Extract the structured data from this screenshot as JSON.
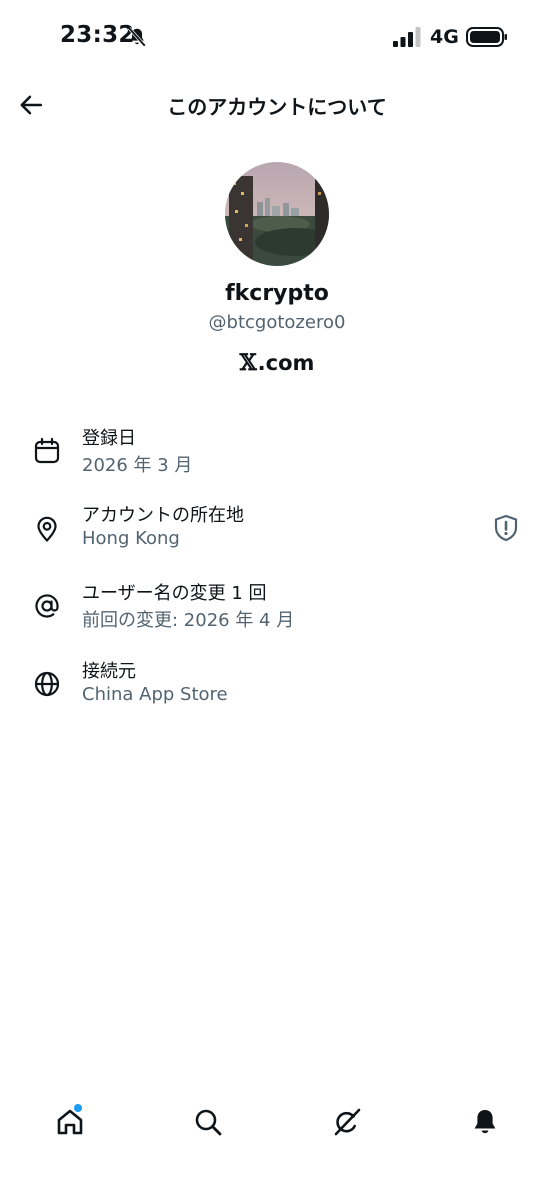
{
  "status_bar": {
    "time": "23:32",
    "network": "4G",
    "icons": [
      "bell-slash-icon",
      "signal-icon",
      "battery-icon"
    ]
  },
  "header": {
    "title": "このアカウントについて",
    "back_icon": "arrow-left-icon"
  },
  "profile": {
    "display_name": "fkcrypto",
    "handle": "@btcgotozero0",
    "platform_glyph": "𝕏",
    "platform_suffix": ".com"
  },
  "info_rows": [
    {
      "icon": "calendar-icon",
      "label": "登録日",
      "value": "2026 年 3 月"
    },
    {
      "icon": "location-pin-icon",
      "label": "アカウントの所在地",
      "value": "Hong Kong",
      "trailing_icon": "shield-alert-icon"
    },
    {
      "icon": "at-sign-icon",
      "label": "ユーザー名の変更 1 回",
      "value": "前回の変更: 2026 年 4 月"
    },
    {
      "icon": "globe-icon",
      "label": "接続元",
      "value": "China App Store"
    }
  ],
  "bottom_nav": {
    "items": [
      "home-icon",
      "search-icon",
      "grok-icon",
      "notifications-bell-icon"
    ],
    "home_has_notification_dot": true
  },
  "colors": {
    "primary_text": "#0f1419",
    "secondary_text": "#536471",
    "accent_blue": "#1d9bf0"
  }
}
